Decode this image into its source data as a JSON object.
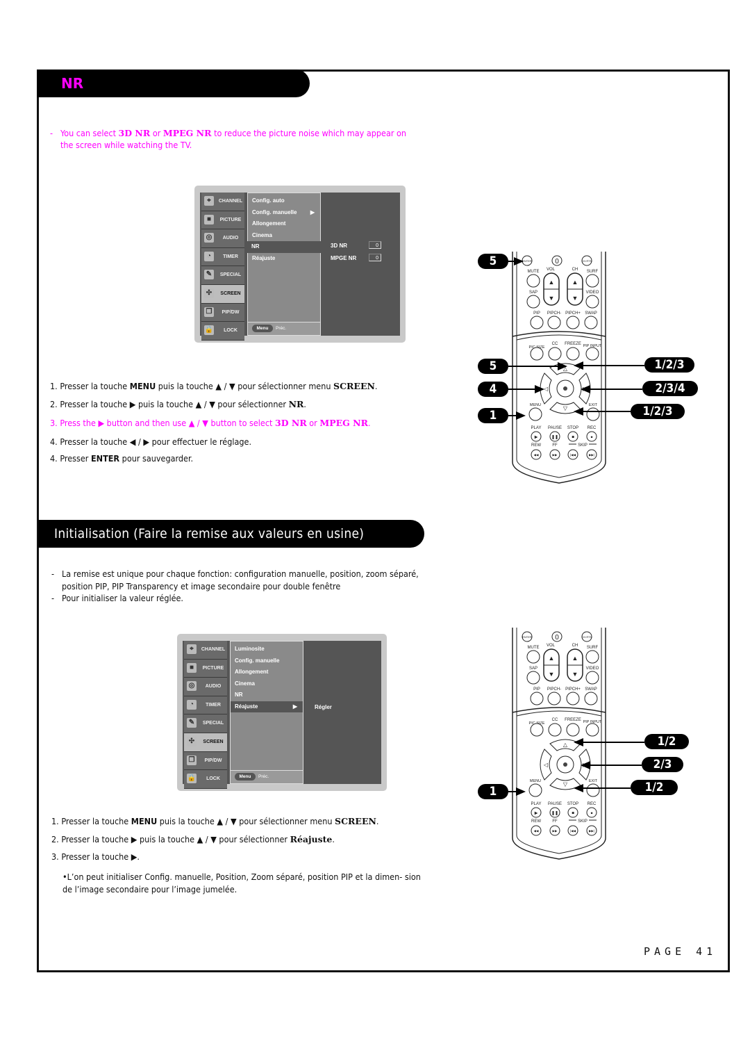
{
  "section_nr": {
    "title": "NR",
    "intro_dash": "-",
    "intro_parts": [
      "You can select ",
      "3D NR",
      " or ",
      "MPEG NR",
      " to reduce the picture noise which may appear on the screen while watching the TV."
    ]
  },
  "osd1": {
    "sidebar": [
      {
        "label": "CHANNEL",
        "icon": "satellite-icon"
      },
      {
        "label": "PICTURE",
        "icon": "picture-icon"
      },
      {
        "label": "AUDIO",
        "icon": "speaker-icon"
      },
      {
        "label": "TIMER",
        "icon": "clock-icon"
      },
      {
        "label": "SPECIAL",
        "icon": "tag-icon"
      },
      {
        "label": "SCREEN",
        "icon": "screen-icon",
        "selected": true
      },
      {
        "label": "PIP/DW",
        "icon": "pip-icon"
      },
      {
        "label": "LOCK",
        "icon": "lock-icon"
      }
    ],
    "menu_top": [
      "Config. auto",
      "Config. manuelle",
      "Allongement",
      "Cinema"
    ],
    "menu_arrow": "▶",
    "menu_selected": "NR",
    "menu_bottom": [
      "Réajuste"
    ],
    "footer_button": "Menu",
    "footer_label": "Préc.",
    "settings": [
      {
        "label": "3D NR",
        "value": "0"
      },
      {
        "label": "MPGE NR",
        "value": "0"
      }
    ]
  },
  "steps_nr": [
    {
      "num": "1.",
      "parts": [
        "Presser la touche ",
        "MENU",
        " puis la touche ▲ / ▼ pour sélectionner menu ",
        "SCREEN",
        "."
      ]
    },
    {
      "num": "2.",
      "parts": [
        "Presser la touche ▶ puis la touche ▲ / ▼ pour sélectionner ",
        "NR",
        "."
      ]
    },
    {
      "num": "3.",
      "parts": [
        "Press the ▶  button and then use ▲ / ▼ button to select ",
        "3D NR",
        " or ",
        "MPEG NR",
        "."
      ]
    },
    {
      "num": "4.",
      "parts": [
        "Presser la touche ◀  / ▶ pour effectuer le réglage."
      ]
    },
    {
      "num": "4.",
      "parts": [
        "Presser ",
        "ENTER",
        " pour sauvegarder."
      ]
    }
  ],
  "remote1": {
    "badges_left": [
      "5",
      "5",
      "4",
      "1"
    ],
    "badges_right": [
      "1/2/3",
      "2/3/4",
      "1/2/3"
    ]
  },
  "section_init": {
    "title": "Initialisation (Faire la remise aux valeurs en usine)",
    "bullets": [
      "La remise est unique pour chaque fonction: configuration manuelle, position, zoom séparé, position PIP, PIP Transparency et image secondaire pour double fenêtre",
      "Pour initialiser la valeur réglée."
    ]
  },
  "osd2": {
    "menu_top": [
      "Luminosite",
      "Config. manuelle",
      "Allongement",
      "Cinema",
      "NR"
    ],
    "menu_selected": "Réajuste",
    "menu_arrow": "▶",
    "right_label": "Régler",
    "footer_button": "Menu",
    "footer_label": "Préc."
  },
  "steps_init": [
    {
      "num": "1.",
      "parts": [
        "Presser la touche ",
        "MENU",
        " puis la touche ▲ / ▼ pour sélectionner menu ",
        "SCREEN",
        "."
      ]
    },
    {
      "num": "2.",
      "parts": [
        "Presser la touche ▶ puis la touche ▲ / ▼ pour sélectionner ",
        "Réajuste",
        "."
      ]
    },
    {
      "num": "3.",
      "parts": [
        "Presser la touche ▶."
      ]
    }
  ],
  "note_init": "•L’on peut initialiser Config. manuelle, Position, Zoom séparé, position PIP et la dimen- sion de l’image secondaire pour l’image jumelée.",
  "remote2": {
    "badges_left": [
      "1"
    ],
    "badges_right": [
      "1/2",
      "2/3",
      "1/2"
    ]
  },
  "remote_labels": {
    "enter": "ENTER",
    "zero": "0",
    "chrtn": "CH.RTN",
    "mute": "MUTE",
    "vol": "VOL",
    "ch": "CH",
    "surf": "SURF",
    "sap": "SAP",
    "video": "VIDEO",
    "pip": "PIP",
    "pipch_minus": "PIPCH-",
    "pipch_plus": "PIPCH+",
    "swap": "SWAP",
    "picsize": "PIC SIZE",
    "cc": "CC",
    "freeze": "FREEZE",
    "pipinput": "PIP INPUT",
    "menu": "MENU",
    "exit": "EXIT",
    "play": "PLAY",
    "pause": "PAUSE",
    "stop": "STOP",
    "rec": "REC",
    "rew": "REW",
    "ff": "FF",
    "skip": "SKIP"
  },
  "page": {
    "label": "PAGE",
    "number": "41"
  },
  "colors": {
    "accent": "#ff00ff",
    "header_bg": "#000000"
  }
}
